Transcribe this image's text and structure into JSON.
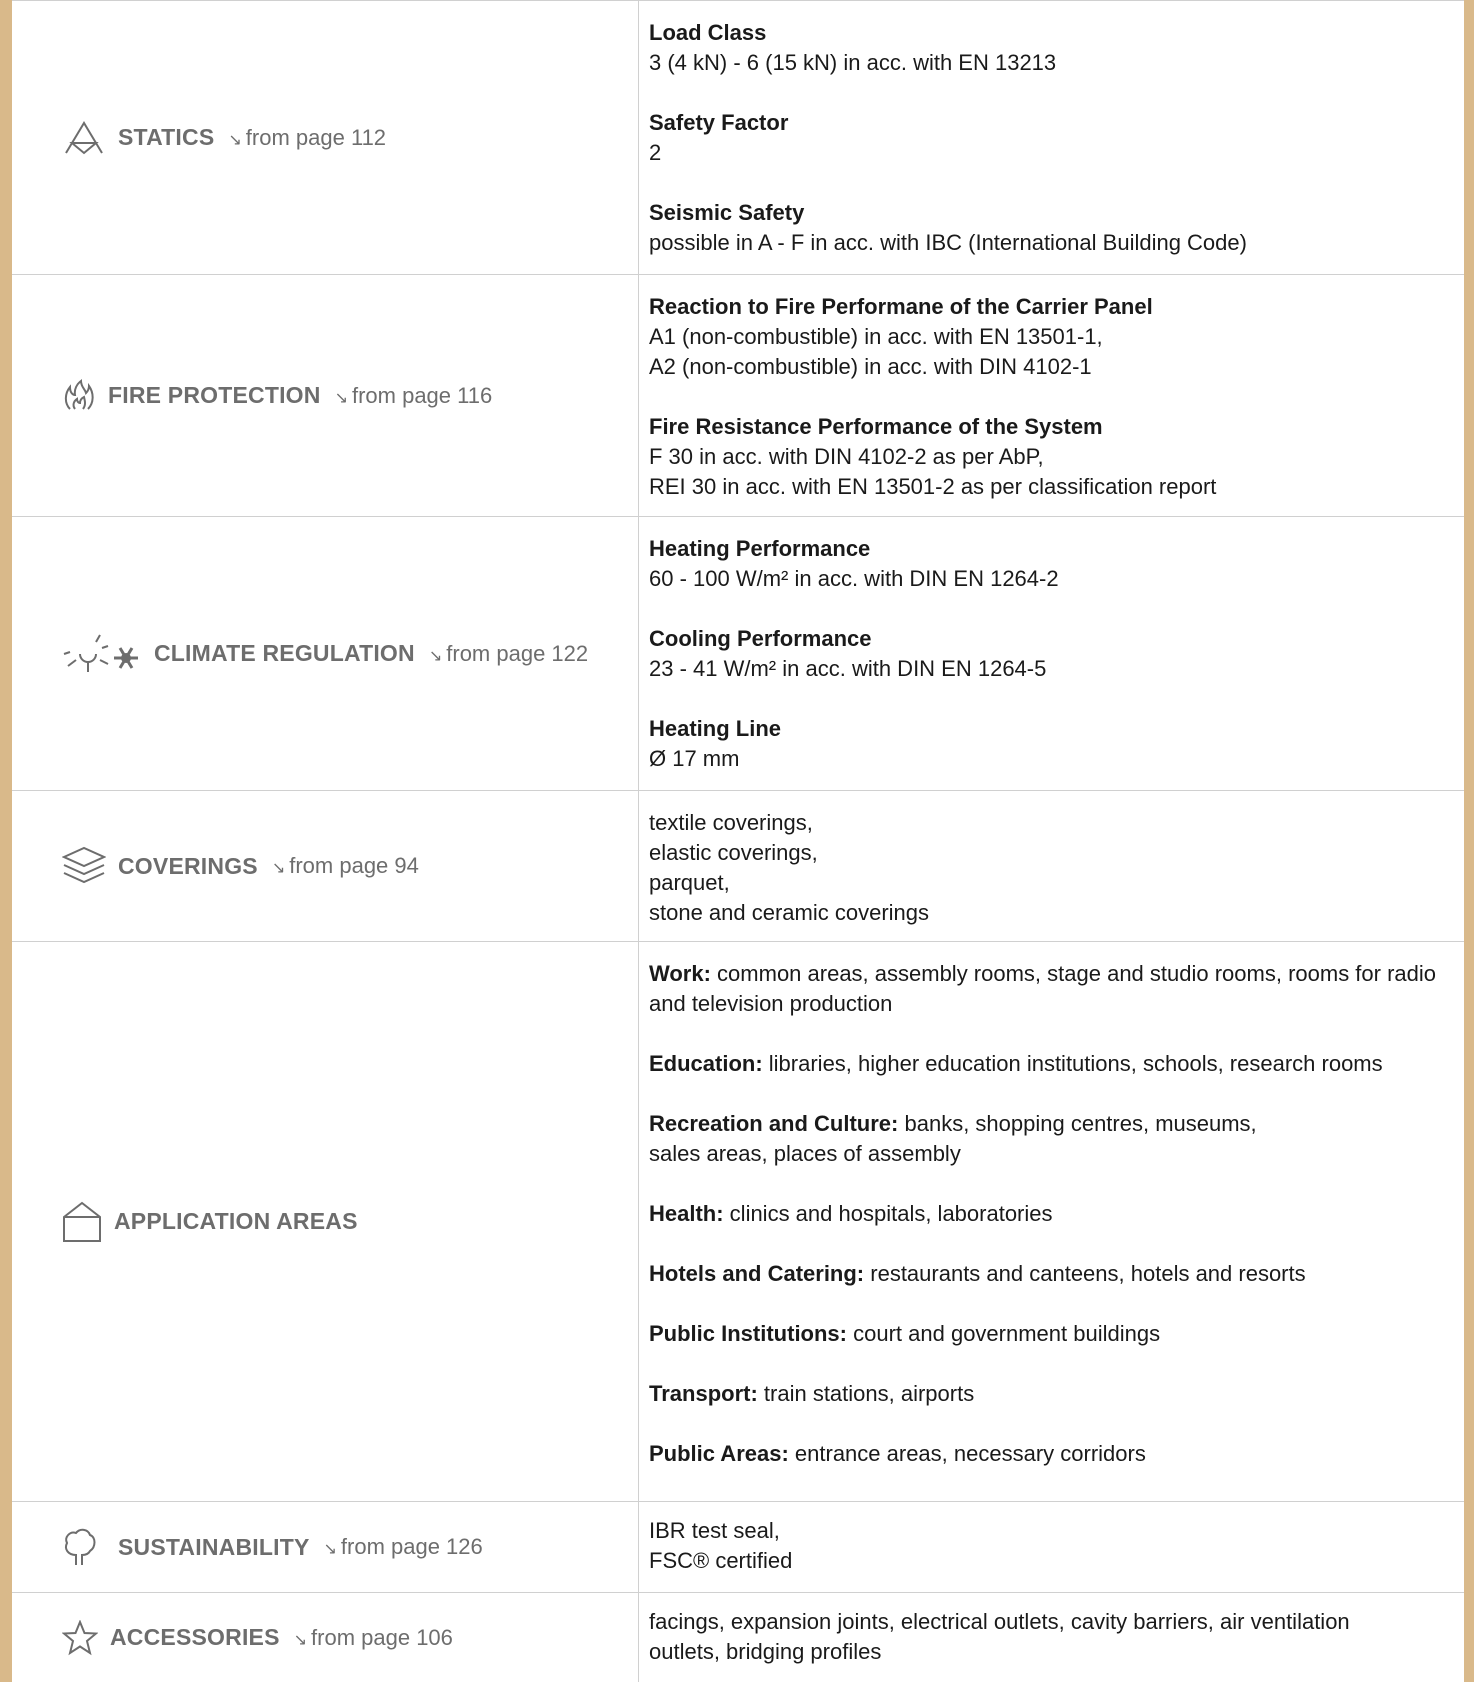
{
  "rows": [
    {
      "category": "STATICS",
      "ref": "from page 112",
      "icon": "statics-icon",
      "items": [
        {
          "label": "Load Class",
          "value": "3 (4 kN) - 6 (15 kN) in acc. with EN 13213"
        },
        {
          "label": "Safety Factor",
          "value": "2"
        },
        {
          "label": "Seismic Safety",
          "value": "possible in A - F in acc. with IBC (International Building Code)"
        }
      ]
    },
    {
      "category": "FIRE PROTECTION",
      "ref": "from page 116",
      "icon": "flame-icon",
      "items": [
        {
          "label": "Reaction to Fire Performane of the Carrier Panel",
          "value": "A1 (non-combustible) in acc. with EN 13501-1,\nA2 (non-combustible) in acc. with DIN 4102-1"
        },
        {
          "label": "Fire Resistance Performance of the System",
          "value": "F 30 in acc. with DIN 4102-2 as per AbP,\nREI 30 in acc. with EN 13501-2 as per classification report"
        }
      ]
    },
    {
      "category": "CLIMATE REGULATION",
      "ref": "from page 122",
      "icon": "sun-snowflake-icon",
      "items": [
        {
          "label": "Heating Performance",
          "value": "60 - 100 W/m² in acc. with DIN EN 1264-2"
        },
        {
          "label": "Cooling Performance",
          "value": "23 - 41 W/m² in acc. with DIN EN 1264-5"
        },
        {
          "label": "Heating Line",
          "value": "Ø 17 mm"
        }
      ]
    },
    {
      "category": "COVERINGS",
      "ref": "from page 94",
      "icon": "layers-icon",
      "lines": [
        "textile coverings,",
        "elastic coverings,",
        "parquet,",
        "stone and ceramic coverings"
      ]
    },
    {
      "category": "APPLICATION AREAS",
      "icon": "house-icon",
      "areas": [
        {
          "lead": "Work:",
          "text": " common areas, assembly rooms, stage and studio rooms, rooms for radio and television production"
        },
        {
          "lead": "Education:",
          "text": " libraries, higher education institutions, schools, research rooms"
        },
        {
          "lead": "Recreation and Culture:",
          "text": " banks, shopping centres, museums,\nsales areas, places of assembly"
        },
        {
          "lead": "Health:",
          "text": " clinics and hospitals, laboratories"
        },
        {
          "lead": "Hotels and Catering:",
          "text": " restaurants and canteens, hotels and resorts"
        },
        {
          "lead": "Public Institutions:",
          "text": " court and government buildings"
        },
        {
          "lead": "Transport:",
          "text": " train stations, airports"
        },
        {
          "lead": "Public Areas:",
          "text": " entrance areas, necessary corridors"
        }
      ]
    },
    {
      "category": "SUSTAINABILITY",
      "ref": "from page 126",
      "icon": "tree-icon",
      "lines": [
        "IBR test seal,",
        "FSC® certified"
      ]
    },
    {
      "category": "ACCESSORIES",
      "ref": "from page 106",
      "icon": "star-icon",
      "lines": [
        "facings, expansion joints, electrical outlets, cavity barriers, air ventilation",
        "outlets, bridging profiles"
      ]
    }
  ],
  "arrow_glyph": "↘",
  "colors": {
    "frame": "#d9b98a",
    "category": "#6d6d6d",
    "border": "#d0d0d0"
  }
}
